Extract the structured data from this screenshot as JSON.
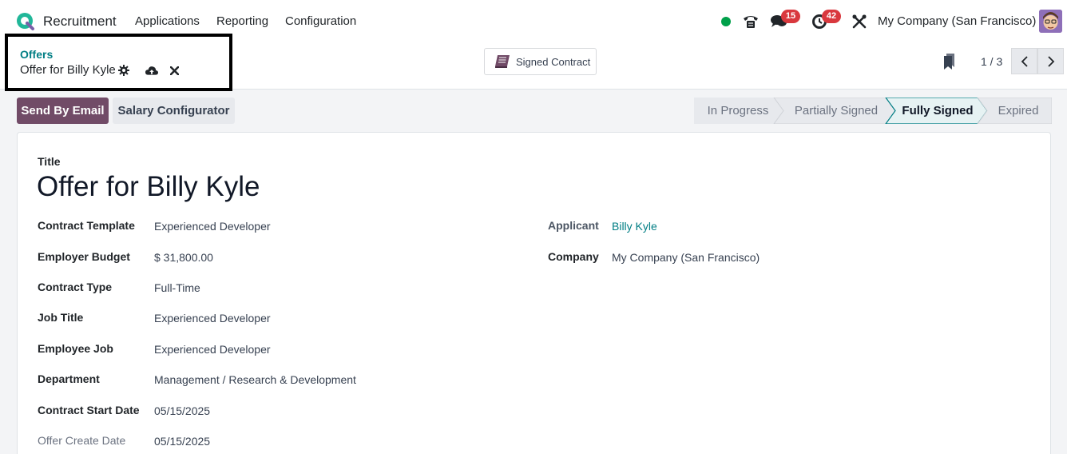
{
  "navbar": {
    "app_name": "Recruitment",
    "menu": [
      "Applications",
      "Reporting",
      "Configuration"
    ],
    "messages_count": "15",
    "activities_count": "42",
    "company": "My Company (San Francisco)",
    "status_color": "#00a04a"
  },
  "breadcrumb": {
    "parent": "Offers",
    "current": "Offer for Billy Kyle"
  },
  "smart_button": {
    "label": "Signed Contract"
  },
  "pager": {
    "value": "1 / 3"
  },
  "actions": {
    "send_email": "Send By Email",
    "salary_configurator": "Salary Configurator"
  },
  "stages": {
    "items": [
      "In Progress",
      "Partially Signed",
      "Fully Signed",
      "Expired"
    ],
    "active": "Fully Signed"
  },
  "form": {
    "title_label": "Title",
    "title_value": "Offer for Billy Kyle",
    "left_fields": [
      {
        "label": "Contract Template",
        "value": "Experienced Developer"
      },
      {
        "label": "Employer Budget",
        "value": "$ 31,800.00"
      },
      {
        "label": "Contract Type",
        "value": "Full-Time"
      },
      {
        "label": "Job Title",
        "value": "Experienced Developer"
      },
      {
        "label": "Employee Job",
        "value": "Experienced Developer"
      },
      {
        "label": "Department",
        "value": "Management / Research & Development"
      },
      {
        "label": "Contract Start Date",
        "value": "05/15/2025"
      },
      {
        "label": "Offer Create Date",
        "value": "05/15/2025"
      }
    ],
    "right_fields": [
      {
        "label": "Applicant",
        "value": "Billy Kyle"
      },
      {
        "label": "Company",
        "value": "My Company (San Francisco)"
      }
    ]
  },
  "colors": {
    "primary": "#714b67",
    "link": "#017e84",
    "badge": "#d9383e"
  }
}
